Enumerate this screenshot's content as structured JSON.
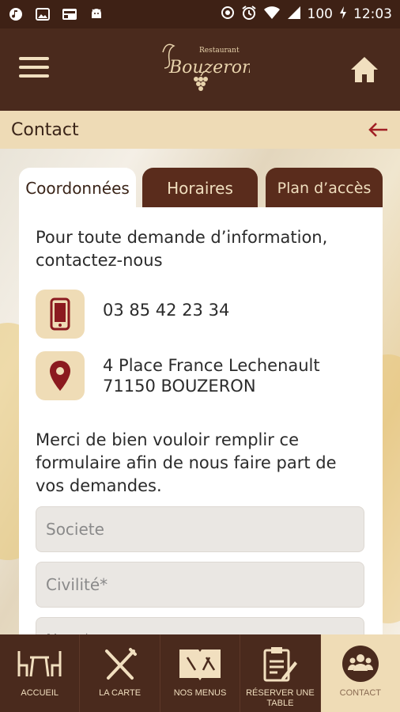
{
  "status_bar": {
    "battery": "100",
    "time": "12:03"
  },
  "header": {
    "logo_small": "Restaurant",
    "logo_name": "Bouzeron"
  },
  "titlebar": {
    "title": "Contact"
  },
  "tabs": [
    {
      "label": "Coordonnées",
      "active": true
    },
    {
      "label": "Horaires",
      "active": false
    },
    {
      "label": "Plan d’accès",
      "active": false
    }
  ],
  "content": {
    "intro": "Pour toute demande d’information, contactez-nous",
    "phone": "03 85 42 23 34",
    "address_line1": "4 Place France Lechenault",
    "address_line2": "71150 BOUZERON",
    "form_intro": "Merci de bien vouloir remplir ce formulaire afin de nous faire part de vos demandes.",
    "fields": [
      {
        "placeholder": "Societe"
      },
      {
        "placeholder": "Civilité*"
      },
      {
        "placeholder": "Nom*"
      }
    ]
  },
  "bottom_nav": [
    {
      "label": "ACCUEIL",
      "icon": "table-chairs-icon",
      "active": false
    },
    {
      "label": "LA CARTE",
      "icon": "fork-knife-icon",
      "active": false
    },
    {
      "label": "NOS MENUS",
      "icon": "menu-book-icon",
      "active": false
    },
    {
      "label": "RÉSERVER UNE TABLE",
      "icon": "reservation-clipboard-icon",
      "active": false
    },
    {
      "label": "CONTACT",
      "icon": "people-group-icon",
      "active": true
    }
  ],
  "colors": {
    "brown": "#4a2a1d",
    "beige": "#efdcb6",
    "accent_red": "#8b1a1f"
  }
}
